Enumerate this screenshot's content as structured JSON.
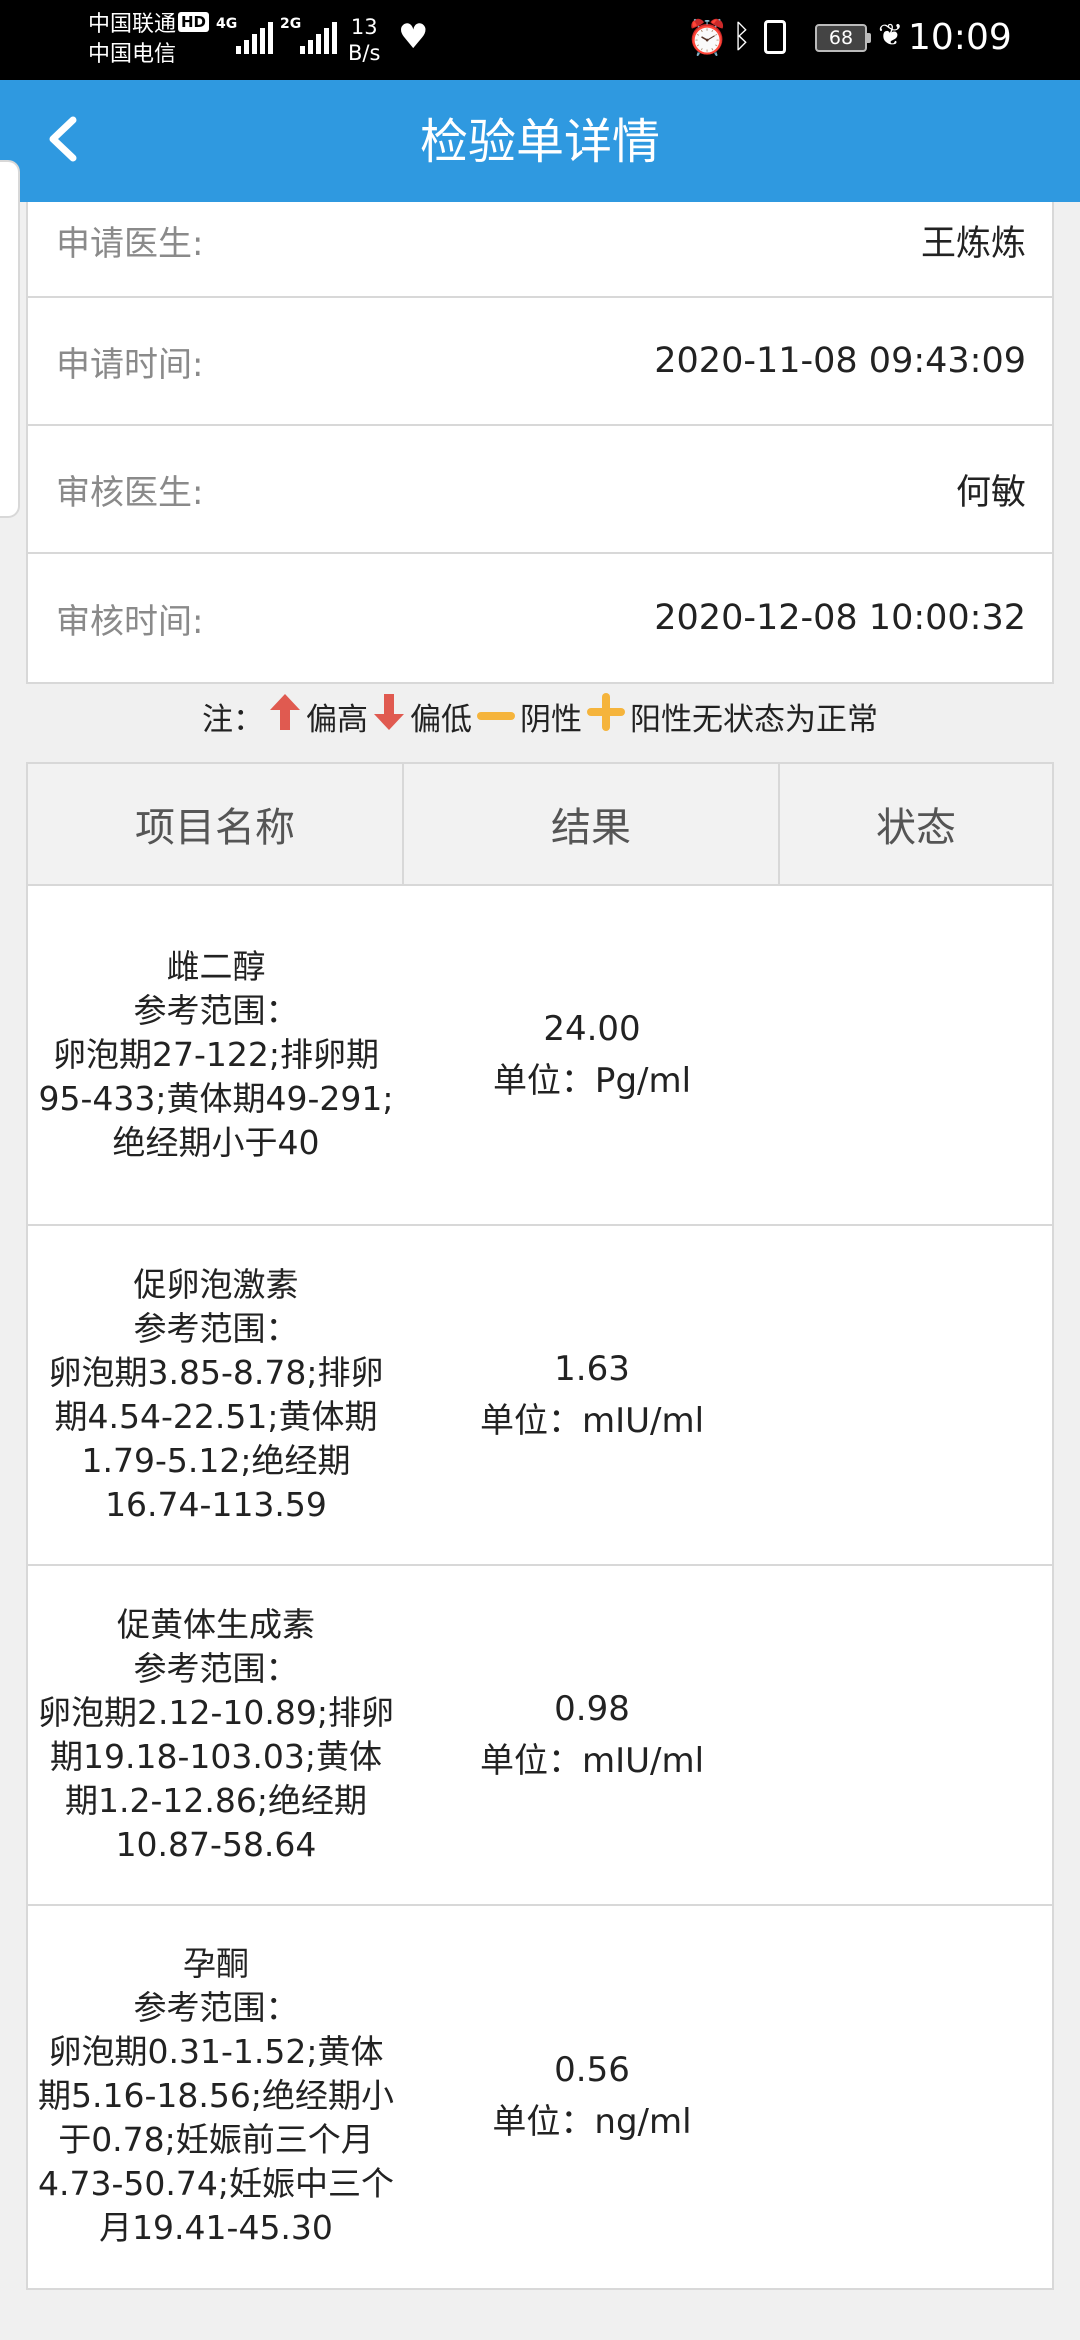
{
  "status_bar": {
    "carrier1": "中国联通",
    "carrier2": "中国电信",
    "hd": "HD",
    "net1": "4G",
    "net2": "2G",
    "speed_value": "13",
    "speed_unit": "B/s",
    "battery": "68",
    "time": "10:09"
  },
  "header": {
    "title": "检验单详情",
    "back_icon": "chevron-left-icon"
  },
  "info": {
    "rows": [
      {
        "label": "申请医生:",
        "value": "王炼炼"
      },
      {
        "label": "申请时间:",
        "value": "2020-11-08 09:43:09"
      },
      {
        "label": "审核医生:",
        "value": "何敏"
      },
      {
        "label": "审核时间:",
        "value": "2020-12-08 10:00:32"
      }
    ]
  },
  "legend": {
    "prefix": "注：",
    "high": "偏高",
    "low": "偏低",
    "negative": "阴性",
    "positive": "阳性",
    "normal_note": "无状态为正常",
    "colors": {
      "high": "#e05a50",
      "low": "#e05a50",
      "negative": "#f5b43c",
      "positive": "#f5b43c"
    }
  },
  "table": {
    "headers": [
      "项目名称",
      "结果",
      "状态"
    ],
    "rows": [
      {
        "name": "雌二醇",
        "range_label": "参考范围：",
        "range": "卵泡期27-122;排卵期95-433;黄体期49-291;绝经期小于40",
        "value": "24.00",
        "unit": "单位：Pg/ml",
        "status": ""
      },
      {
        "name": "促卵泡激素",
        "range_label": "参考范围：",
        "range": "卵泡期3.85-8.78;排卵期4.54-22.51;黄体期1.79-5.12;绝经期16.74-113.59",
        "value": "1.63",
        "unit": "单位：mIU/ml",
        "status": ""
      },
      {
        "name": "促黄体生成素",
        "range_label": "参考范围：",
        "range": "卵泡期2.12-10.89;排卵期19.18-103.03;黄体期1.2-12.86;绝经期10.87-58.64",
        "value": "0.98",
        "unit": "单位：mIU/ml",
        "status": ""
      },
      {
        "name": "孕酮",
        "range_label": "参考范围：",
        "range": "卵泡期0.31-1.52;黄体期5.16-18.56;绝经期小于0.78;妊娠前三个月4.73-50.74;妊娠中三个月19.41-45.30",
        "value": "0.56",
        "unit": "单位：ng/ml",
        "status": ""
      }
    ]
  }
}
